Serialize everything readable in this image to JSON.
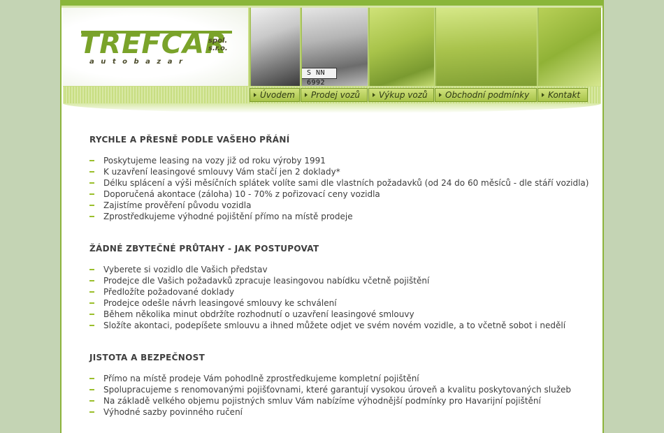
{
  "logo": {
    "name": "TREFCAR",
    "legal_form": "spol. s.r.o.",
    "legal_form_line1": "spol.",
    "legal_form_line2": "s.r.o.",
    "tagline": "autobazar"
  },
  "header": {
    "license_plate": "S NN 6992"
  },
  "nav": {
    "items": [
      {
        "label": "Úvodem"
      },
      {
        "label": "Prodej vozů"
      },
      {
        "label": "Výkup vozů"
      },
      {
        "label": "Obchodní podmínky"
      },
      {
        "label": "Kontakt"
      }
    ]
  },
  "sections": [
    {
      "title": "RYCHLE A PŘESNĚ PODLE VAŠEHO PŘÁNÍ",
      "items": [
        "Poskytujeme leasing na vozy již od roku výroby 1991",
        "K uzavření leasingové smlouvy Vám stačí jen 2 doklady*",
        "Délku splácení a výši měsíčních splátek volíte sami dle vlastních požadavků (od 24 do 60 měsíců - dle stáří vozidla)",
        "Doporučená akontace (záloha) 10 - 70% z pořizovací ceny vozidla",
        "Zajistíme prověření původu vozidla",
        "Zprostředkujeme výhodné pojištění přímo na místě prodeje"
      ]
    },
    {
      "title": "ŽÁDNÉ ZBYTEČNÉ PRŮTAHY - JAK POSTUPOVAT",
      "items": [
        "Vyberete si vozidlo dle Vašich představ",
        "Prodejce dle Vašich požadavků zpracuje leasingovou nabídku včetně pojištění",
        "Předložíte požadované doklady",
        "Prodejce odešle návrh leasingové smlouvy ke schválení",
        "Během několika minut obdržíte rozhodnutí o uzavření leasingové smlouvy",
        "Složíte akontaci, podepíšete smlouvu a ihned můžete odjet ve svém novém vozidle, a to včetně sobot i nedělí"
      ]
    },
    {
      "title": "JISTOTA A BEZPEČNOST",
      "items": [
        "Přímo na místě prodeje Vám pohodlně zprostředkujeme kompletní pojištění",
        "Spolupracujeme s renomovanými pojišťovnami, které garantují vysokou úroveň a kvalitu poskytovaných služeb",
        "Na základě velkého objemu pojistných smluv Vám nabízíme výhodnější podmínky pro Havarijní pojištění",
        "Výhodné sazby povinného ručení"
      ]
    }
  ],
  "colors": {
    "accent": "#8ab63a",
    "background": "#c4d4b4",
    "bullet": "#9bbf2c",
    "text": "#3d3d3d"
  }
}
